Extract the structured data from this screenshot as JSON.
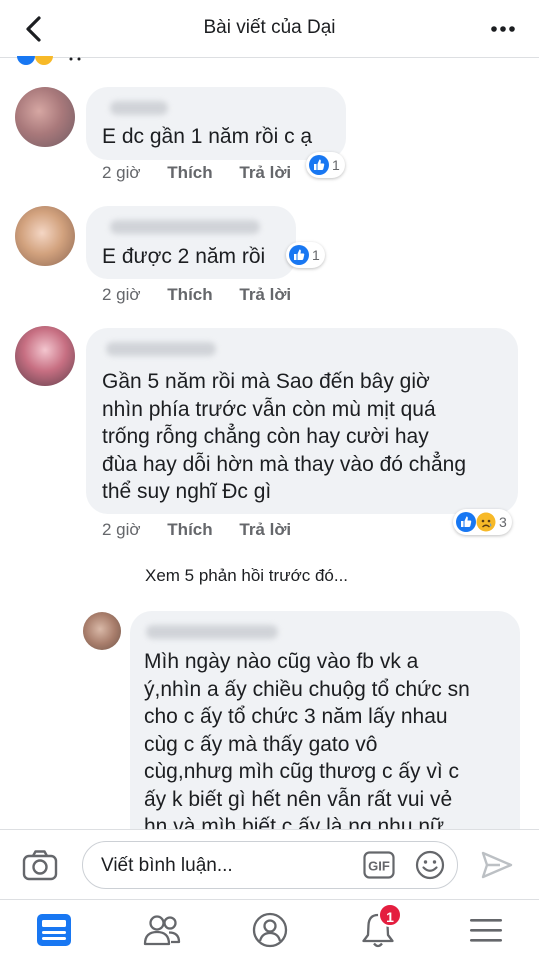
{
  "header": {
    "title": "Bài viết của Dại"
  },
  "comments": [
    {
      "text_lines": [
        "E dc gần 1 năm rồi c ạ"
      ],
      "time": "2 giờ",
      "like_label": "Thích",
      "reply_label": "Trả lời",
      "reaction_count": "1",
      "reactions": [
        "like-icon"
      ]
    },
    {
      "text_lines": [
        "E được 2 năm rồi"
      ],
      "time": "2 giờ",
      "like_label": "Thích",
      "reply_label": "Trả lời",
      "reaction_count": "1",
      "reactions": [
        "like-icon"
      ]
    },
    {
      "text_lines": [
        "Gần 5 năm rồi mà Sao đến bây giờ",
        "nhìn phía trước vẫn còn mù mịt quá",
        "trống rỗng chẳng còn hay cười hay",
        "đùa hay dỗi hờn mà thay vào đó chẳng",
        "thể suy nghĩ Đc gì"
      ],
      "time": "2 giờ",
      "like_label": "Thích",
      "reply_label": "Trả lời",
      "reaction_count": "3",
      "reactions": [
        "like-icon",
        "sad-icon"
      ]
    }
  ],
  "previous_replies_label": "Xem 5 phản hồi trước đó...",
  "reply": {
    "text_lines": [
      "Mìh ngày nào cũg vào fb vk a",
      "ý,nhìn a ấy chiều chuộg tổ chức sn",
      "cho c ấy tổ chức 3 năm lấy nhau",
      "cùg c ấy mà thấy gato vô",
      "cùg,nhưg mìh cũg thươg c ấy vì c",
      "ấy k biết gì hết nên vẫn rất vui vẻ",
      "hn và mìh biết c ấy là ng nhu nữ"
    ]
  },
  "composer": {
    "placeholder": "Viết bình luận...",
    "gif_label": "GIF"
  },
  "nav": {
    "notification_badge": "1"
  },
  "colors": {
    "accent": "#1877f2",
    "bubble": "#f0f2f5",
    "badge": "#e41e3f",
    "icon_gray": "#65676b"
  }
}
